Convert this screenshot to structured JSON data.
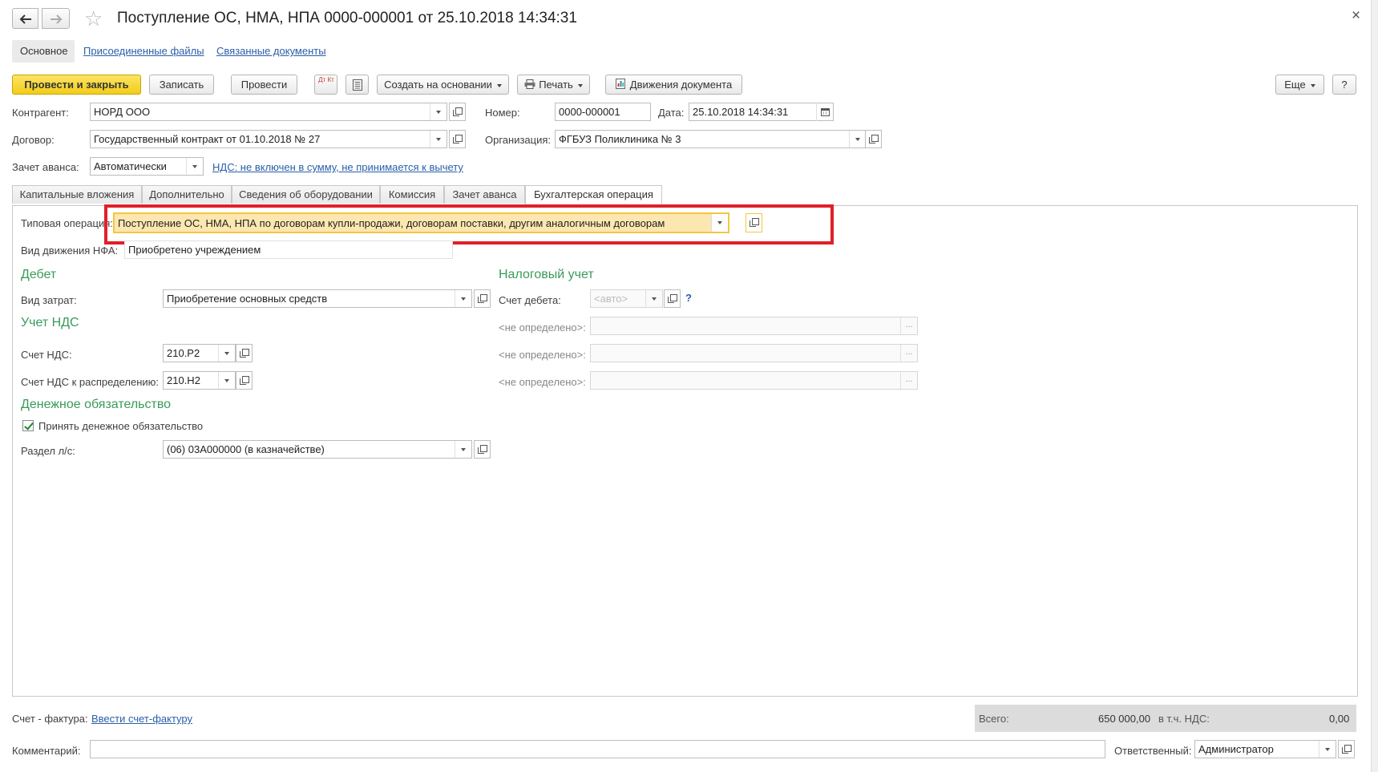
{
  "window": {
    "title": "Поступление ОС, НМА, НПА 0000-000001 от 25.10.2018 14:34:31",
    "close_glyph": "×",
    "star_glyph": "☆"
  },
  "nav_tabs": {
    "main": "Основное",
    "attached_files": "Присоединенные файлы",
    "related_docs": "Связанные документы"
  },
  "toolbar": {
    "post_and_close": "Провести и закрыть",
    "save": "Записать",
    "post": "Провести",
    "dt_kt": "Дт Кт",
    "create_based_on": "Создать на основании",
    "print": "Печать",
    "doc_movements": "Движения документа",
    "more": "Еще",
    "help": "?"
  },
  "header": {
    "counterparty_label": "Контрагент:",
    "counterparty_value": "НОРД ООО",
    "number_label": "Номер:",
    "number_value": "0000-000001",
    "date_label": "Дата:",
    "date_value": "25.10.2018 14:34:31",
    "contract_label": "Договор:",
    "contract_value": "Государственный контракт от 01.10.2018 № 27",
    "organization_label": "Организация:",
    "organization_value": "ФГБУЗ Поликлиника № 3",
    "advance_label": "Зачет аванса:",
    "advance_value": "Автоматически",
    "vat_link": "НДС: не включен в сумму, не принимается к вычету"
  },
  "tabs": [
    {
      "label": "Капитальные вложения"
    },
    {
      "label": "Дополнительно"
    },
    {
      "label": "Сведения об оборудовании"
    },
    {
      "label": "Комиссия"
    },
    {
      "label": "Зачет аванса"
    },
    {
      "label": "Бухгалтерская операция"
    }
  ],
  "operation": {
    "typical_label": "Типовая операция:",
    "typical_value": "Поступление ОС, НМА, НПА по договорам купли-продажи, договорам поставки, другим аналогичным договорам",
    "movement_label": "Вид движения НФА:",
    "movement_value": "Приобретено учреждением"
  },
  "debit": {
    "heading": "Дебет",
    "cost_type_label": "Вид затрат:",
    "cost_type_value": "Приобретение основных средств"
  },
  "tax": {
    "heading": "Налоговый учет",
    "debit_account_label": "Счет дебета:",
    "debit_account_placeholder": "<авто>",
    "help_mark": "?",
    "undefined_label": "<не определено>:",
    "ellipsis": "..."
  },
  "vat": {
    "heading": "Учет НДС",
    "account_label": "Счет НДС:",
    "account_value": "210.Р2",
    "distribution_label": "Счет НДС к распределению:",
    "distribution_value": "210.Н2"
  },
  "obligation": {
    "heading": "Денежное обязательство",
    "accept_label": "Принять денежное обязательство",
    "accept_checked": true,
    "section_label": "Раздел л/с:",
    "section_value": "(06) 03А000000 (в казначействе)"
  },
  "footer": {
    "invoice_label": "Счет - фактура:",
    "invoice_link": "Ввести счет-фактуру",
    "total_label": "Всего:",
    "total_value": "650 000,00",
    "vat_included_label": "в т.ч. НДС:",
    "vat_included_value": "0,00",
    "comment_label": "Комментарий:",
    "comment_value": "",
    "responsible_label": "Ответственный:",
    "responsible_value": "Администратор"
  },
  "colors": {
    "primary_button": "#f2cc1a",
    "highlight_box": "#e0202a",
    "section_heading": "#3a9a5a",
    "link": "#2a5fa8",
    "focused_field": "#fde7b0"
  }
}
